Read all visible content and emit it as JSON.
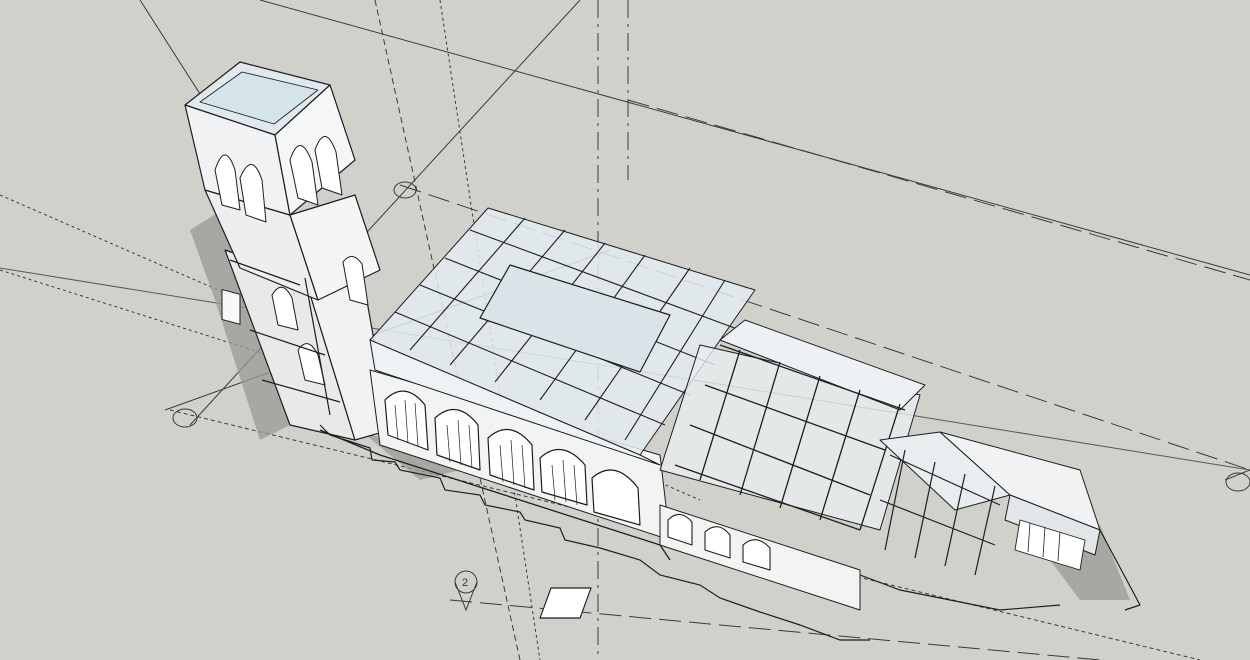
{
  "app": {
    "view_type": "3D model viewport",
    "background_color": "#d1d1cc",
    "line_color": "#222222",
    "glass_color": "#e6eef2"
  },
  "gridlines": {
    "bubble_labels": [
      "2"
    ]
  }
}
